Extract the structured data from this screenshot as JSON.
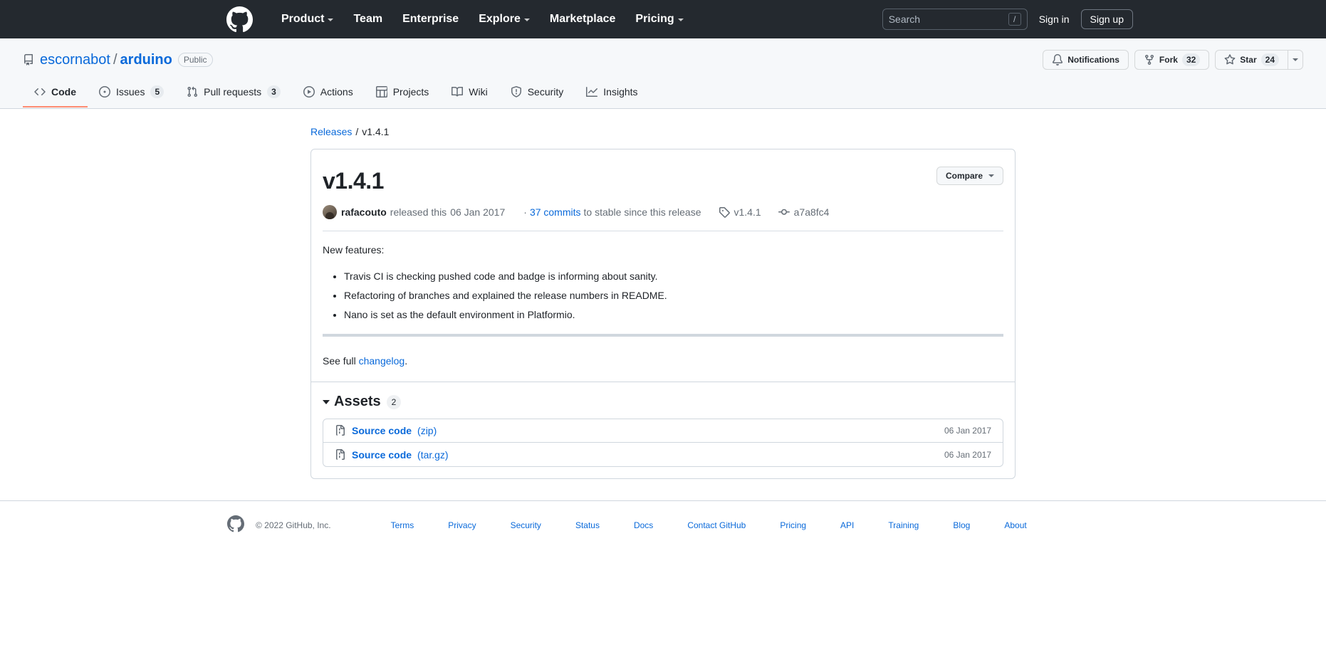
{
  "global_header": {
    "logo_icon": "github-mark-icon",
    "nav": [
      {
        "label": "Product",
        "has_caret": true
      },
      {
        "label": "Team",
        "has_caret": false
      },
      {
        "label": "Enterprise",
        "has_caret": false
      },
      {
        "label": "Explore",
        "has_caret": true
      },
      {
        "label": "Marketplace",
        "has_caret": false
      },
      {
        "label": "Pricing",
        "has_caret": true
      }
    ],
    "search": {
      "placeholder": "Search",
      "shortcut_key": "/"
    },
    "sign_in_label": "Sign in",
    "sign_up_label": "Sign up"
  },
  "repo": {
    "icon": "repo-icon",
    "owner": "escornabot",
    "separator": "/",
    "name": "arduino",
    "visibility": "Public",
    "actions": {
      "notifications_label": "Notifications",
      "fork_label": "Fork",
      "fork_count": "32",
      "star_label": "Star",
      "star_count": "24"
    },
    "tabs": [
      {
        "label": "Code",
        "icon": "code-icon",
        "count": null,
        "active": true
      },
      {
        "label": "Issues",
        "icon": "issue-opened-icon",
        "count": "5",
        "active": false
      },
      {
        "label": "Pull requests",
        "icon": "git-pull-request-icon",
        "count": "3",
        "active": false
      },
      {
        "label": "Actions",
        "icon": "play-icon",
        "count": null,
        "active": false
      },
      {
        "label": "Projects",
        "icon": "table-icon",
        "count": null,
        "active": false
      },
      {
        "label": "Wiki",
        "icon": "book-icon",
        "count": null,
        "active": false
      },
      {
        "label": "Security",
        "icon": "shield-icon",
        "count": null,
        "active": false
      },
      {
        "label": "Insights",
        "icon": "graph-icon",
        "count": null,
        "active": false
      }
    ]
  },
  "breadcrumb": {
    "releases_label": "Releases",
    "separator": "/",
    "current": "v1.4.1"
  },
  "release": {
    "title": "v1.4.1",
    "compare_label": "Compare",
    "author": "rafacouto",
    "released_text": "released this",
    "released_date": "06 Jan 2017",
    "commits_prefix": "·",
    "commits_link": "37 commits",
    "commits_suffix": "to stable since this release",
    "tag_icon": "tag-icon",
    "tag_name": "v1.4.1",
    "commit_icon": "git-commit-icon",
    "commit_hash": "a7a8fc4",
    "notes_intro": "New features:",
    "notes_items": [
      "Travis CI is checking pushed code and badge is informing about sanity.",
      "Refactoring of branches and explained the release numbers in README.",
      "Nano is set as the default environment in Platformio."
    ],
    "changelog_prefix": "See full ",
    "changelog_link": "changelog",
    "changelog_suffix": "."
  },
  "assets": {
    "title": "Assets",
    "count": "2",
    "rows": [
      {
        "icon": "file-zip-icon",
        "name": "Source code",
        "ext": "(zip)",
        "date": "06 Jan 2017"
      },
      {
        "icon": "file-zip-icon",
        "name": "Source code",
        "ext": "(tar.gz)",
        "date": "06 Jan 2017"
      }
    ]
  },
  "footer": {
    "logo_icon": "github-mark-icon",
    "copyright": "© 2022 GitHub, Inc.",
    "links": [
      "Terms",
      "Privacy",
      "Security",
      "Status",
      "Docs",
      "Contact GitHub",
      "Pricing",
      "API",
      "Training",
      "Blog",
      "About"
    ]
  },
  "colors": {
    "header_bg": "#24292f",
    "accent_link": "#0969da",
    "active_tab_underline": "#fd8c73",
    "border": "#d0d7de",
    "muted_text": "#656d76"
  }
}
